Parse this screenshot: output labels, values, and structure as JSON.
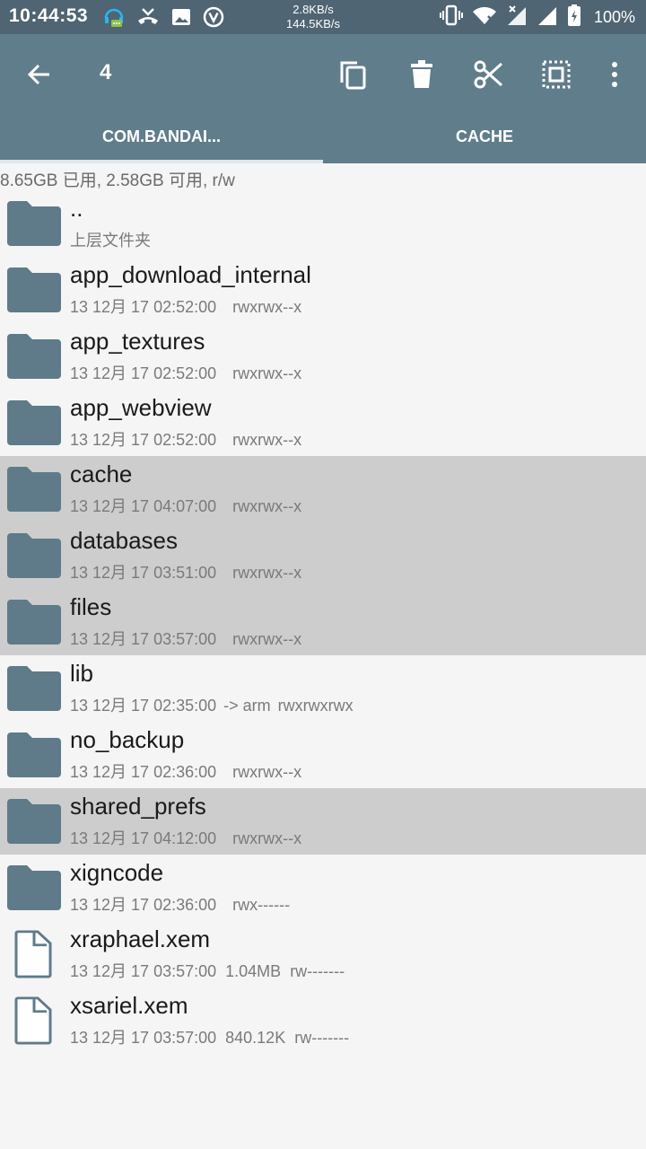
{
  "status_bar": {
    "time": "10:44:53",
    "net_up": "2.8KB/s",
    "net_down": "144.5KB/s",
    "battery": "100%"
  },
  "toolbar": {
    "selection_count": "4"
  },
  "tabs": [
    {
      "label": "COM.BANDAI...",
      "active": true
    },
    {
      "label": "CACHE",
      "active": false
    }
  ],
  "storage_info": "8.65GB 已用, 2.58GB 可用, r/w",
  "items": [
    {
      "type": "folder",
      "name": "..",
      "date": "上层文件夹",
      "selected": false
    },
    {
      "type": "folder",
      "name": "app_download_internal",
      "date": "13 12月 17 02:52:00",
      "perms": "rwxrwx--x",
      "selected": false
    },
    {
      "type": "folder",
      "name": "app_textures",
      "date": "13 12月 17 02:52:00",
      "perms": "rwxrwx--x",
      "selected": false
    },
    {
      "type": "folder",
      "name": "app_webview",
      "date": "13 12月 17 02:52:00",
      "perms": "rwxrwx--x",
      "selected": false
    },
    {
      "type": "folder",
      "name": "cache",
      "date": "13 12月 17 04:07:00",
      "perms": "rwxrwx--x",
      "selected": true
    },
    {
      "type": "folder",
      "name": "databases",
      "date": "13 12月 17 03:51:00",
      "perms": "rwxrwx--x",
      "selected": true
    },
    {
      "type": "folder",
      "name": "files",
      "date": "13 12月 17 03:57:00",
      "perms": "rwxrwx--x",
      "selected": true
    },
    {
      "type": "folder",
      "name": "lib",
      "date": "13 12月 17 02:35:00",
      "link": "-> arm",
      "perms": "rwxrwxrwx",
      "selected": false
    },
    {
      "type": "folder",
      "name": "no_backup",
      "date": "13 12月 17 02:36:00",
      "perms": "rwxrwx--x",
      "selected": false
    },
    {
      "type": "folder",
      "name": "shared_prefs",
      "date": "13 12月 17 04:12:00",
      "perms": "rwxrwx--x",
      "selected": true
    },
    {
      "type": "folder",
      "name": "xigncode",
      "date": "13 12月 17 02:36:00",
      "perms": "rwx------",
      "selected": false
    },
    {
      "type": "file",
      "name": "xraphael.xem",
      "date": "13 12月 17 03:57:00",
      "size": "1.04MB",
      "perms": "rw-------",
      "selected": false
    },
    {
      "type": "file",
      "name": "xsariel.xem",
      "date": "13 12月 17 03:57:00",
      "size": "840.12K",
      "perms": "rw-------",
      "selected": false
    }
  ],
  "colors": {
    "status_bar": "#4f6573",
    "app_bar": "#607d8b",
    "folder_icon": "#5f7b8a",
    "selected_row": "#cdcdcd"
  }
}
